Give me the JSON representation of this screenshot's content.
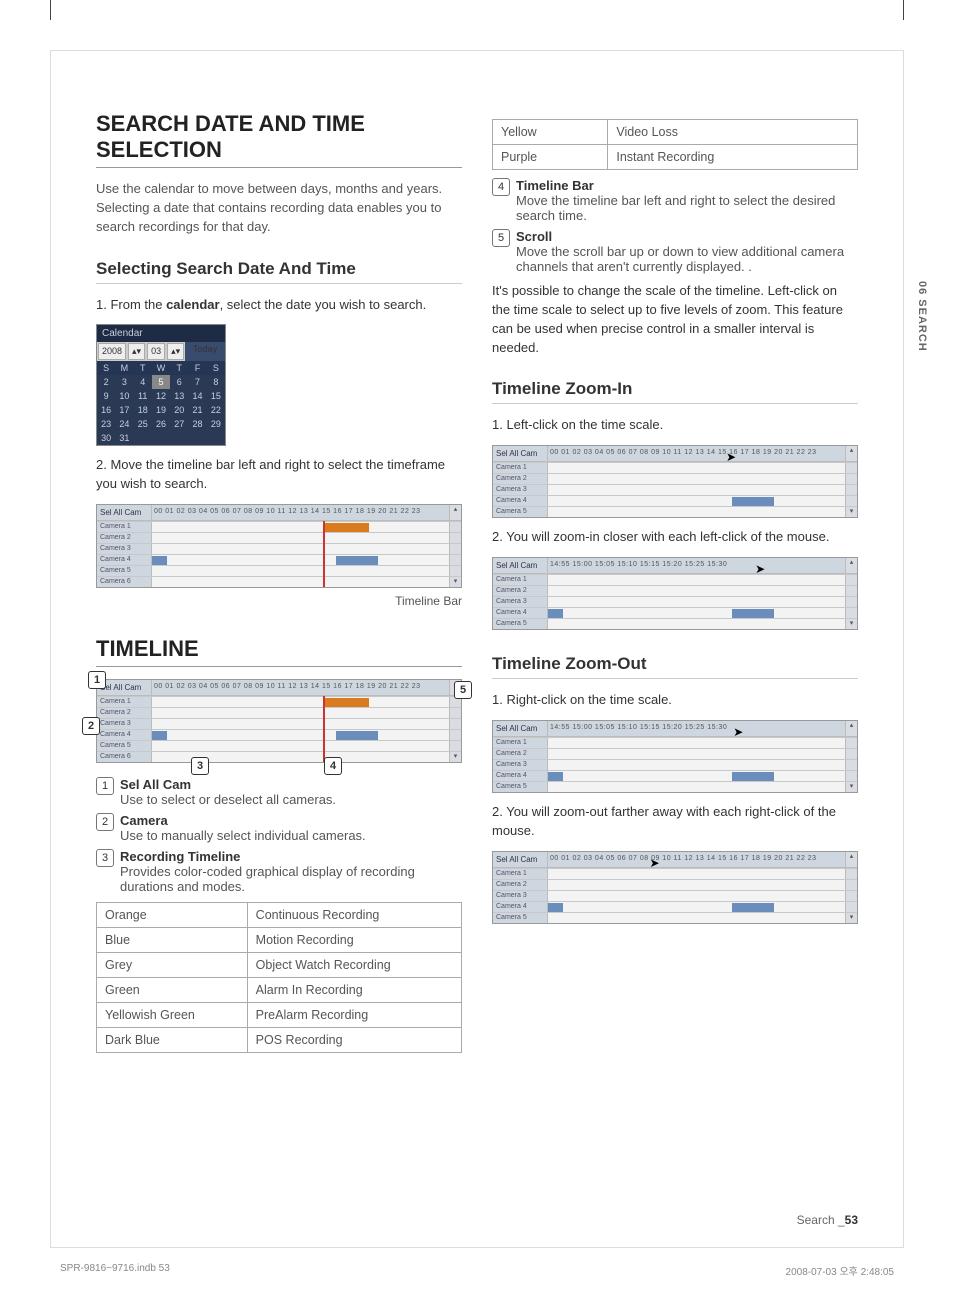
{
  "side_label": "06 SEARCH",
  "left": {
    "h1": "SEARCH DATE AND TIME SELECTION",
    "intro": "Use the calendar to move between days, months and years. Selecting a date that contains recording data enables you to search recordings for that day.",
    "h2": "Selecting Search Date And Time",
    "step1_a": "1. From the ",
    "step1_b": "calendar",
    "step1_c": ", select the date you wish to search.",
    "calendar": {
      "title": "Calendar",
      "year": "2008",
      "month": "03",
      "today": "Today",
      "dow": [
        "S",
        "M",
        "T",
        "W",
        "T",
        "F",
        "S"
      ],
      "rows": [
        [
          "",
          "",
          "",
          "",
          "",
          "",
          ""
        ],
        [
          "2",
          "3",
          "4",
          "5",
          "6",
          "7",
          "8"
        ],
        [
          "9",
          "10",
          "11",
          "12",
          "13",
          "14",
          "15"
        ],
        [
          "16",
          "17",
          "18",
          "19",
          "20",
          "21",
          "22"
        ],
        [
          "23",
          "24",
          "25",
          "26",
          "27",
          "28",
          "29"
        ],
        [
          "30",
          "31",
          "",
          "",
          "",
          "",
          ""
        ]
      ],
      "sel_day": "5"
    },
    "step2": "2. Move the timeline bar left and right to select the timeframe you wish to search.",
    "tl_caption": "Timeline Bar",
    "h1b": "TIMELINE",
    "defs": [
      {
        "n": "1",
        "t": "Sel All Cam",
        "d": "Use to select or deselect all cameras."
      },
      {
        "n": "2",
        "t": "Camera",
        "d": "Use to manually select individual cameras."
      },
      {
        "n": "3",
        "t": "Recording Timeline",
        "d": "Provides color-coded graphical display of recording durations and modes."
      }
    ],
    "color_rows": [
      [
        "Orange",
        "Continuous Recording"
      ],
      [
        "Blue",
        "Motion Recording"
      ],
      [
        "Grey",
        "Object Watch Recording"
      ],
      [
        "Green",
        "Alarm In Recording"
      ],
      [
        "Yellowish Green",
        "PreAlarm Recording"
      ],
      [
        "Dark Blue",
        "POS Recording"
      ]
    ]
  },
  "right": {
    "color_rows_top": [
      [
        "Yellow",
        "Video Loss"
      ],
      [
        "Purple",
        "Instant Recording"
      ]
    ],
    "defs45": [
      {
        "n": "4",
        "t": "Timeline Bar",
        "d": "Move the timeline bar left and right to select the desired search time."
      },
      {
        "n": "5",
        "t": "Scroll",
        "d": "Move the scroll bar up or down to view additional camera channels that aren't currently displayed. ."
      }
    ],
    "zoom_note": "It's possible to change the scale of the timeline. Left-click on the time scale to select up to five levels of zoom. This feature can be used when precise control in a smaller interval is needed.",
    "h2_zin": "Timeline Zoom-In",
    "zin_s1": "1. Left-click on the time scale.",
    "zin_s2": "2. You will zoom-in closer with each left-click of the mouse.",
    "h2_zout": "Timeline Zoom-Out",
    "zout_s1": "1. Right-click on the time scale.",
    "zout_s2": "2. You will zoom-out farther away with each right-click of the mouse."
  },
  "timeline_labels": {
    "selall": "Sel All Cam",
    "cameras": [
      "Camera 1",
      "Camera 2",
      "Camera 3",
      "Camera 4",
      "Camera 5",
      "Camera 6"
    ],
    "scale24": "00  01  02  03  04  05  06  07  08  09  10  11  12  13  14  15  16  17  18  19  20  21  22  23",
    "scale_zoom": "14:55    15:00    15:05    15:10    15:15    15:20    15:25    15:30"
  },
  "footer": {
    "section": "Search _",
    "page": "53",
    "file": "SPR-9816~9716.indb   53",
    "date": "2008-07-03   오후 2:48:05"
  }
}
